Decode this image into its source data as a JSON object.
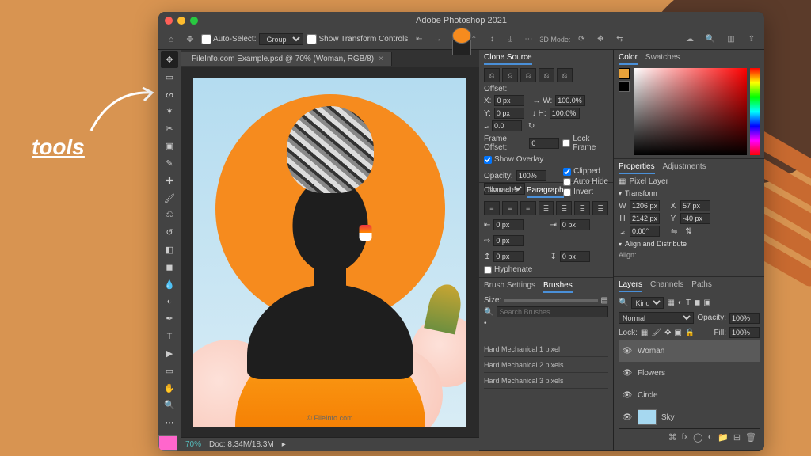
{
  "page": {
    "annotation": "tools"
  },
  "title": "Adobe Photoshop 2021",
  "menubar": {
    "auto_select": "Auto-Select:",
    "group": "Group",
    "show_transform": "Show Transform Controls",
    "mode_label": "3D Mode:"
  },
  "tab": {
    "label": "FileInfo.com Example.psd @ 70% (Woman, RGB/8)"
  },
  "status": {
    "zoom": "70%",
    "doc": "Doc: 8.34M/18.3M"
  },
  "canvas": {
    "watermark": "© FileInfo.com"
  },
  "panels": {
    "clone": {
      "title": "Clone Source",
      "offset": "Offset:",
      "x": "0 px",
      "y": "0 px",
      "w": "100.0%",
      "h": "100.0%",
      "angle": "0.0",
      "frame_offset": "Frame Offset:",
      "frame_val": "0",
      "lock": "Lock Frame",
      "show_overlay": "Show Overlay",
      "clipped": "Clipped",
      "auto_hide": "Auto Hide",
      "invert": "Invert",
      "opacity_label": "Opacity:",
      "opacity": "100%",
      "blend": "Normal"
    },
    "char": {
      "tab1": "Character",
      "tab2": "Paragraph",
      "left": "0 px",
      "right": "0 px",
      "first": "0 px",
      "before": "0 px",
      "after": "0 px",
      "hyphenate": "Hyphenate"
    },
    "brushes": {
      "tab1": "Brush Settings",
      "tab2": "Brushes",
      "size": "Size:",
      "search": "Search Brushes",
      "b1": "Hard Mechanical 1 pixel",
      "b2": "Hard Mechanical 2 pixels",
      "b3": "Hard Mechanical 3 pixels"
    },
    "color": {
      "tab1": "Color",
      "tab2": "Swatches"
    },
    "props": {
      "tab1": "Properties",
      "tab2": "Adjustments",
      "kind": "Pixel Layer",
      "transform": "Transform",
      "w": "1206 px",
      "x": "57 px",
      "h": "2142 px",
      "y": "-40 px",
      "angle": "0.00°",
      "align": "Align and Distribute",
      "align_lbl": "Align:"
    },
    "layers": {
      "tab1": "Layers",
      "tab2": "Channels",
      "tab3": "Paths",
      "kind": "Kind",
      "blend": "Normal",
      "opacity_lbl": "Opacity:",
      "opacity": "100%",
      "lock": "Lock:",
      "fill_lbl": "Fill:",
      "fill": "100%",
      "items": [
        "Woman",
        "Flowers",
        "Circle",
        "Sky"
      ]
    }
  }
}
